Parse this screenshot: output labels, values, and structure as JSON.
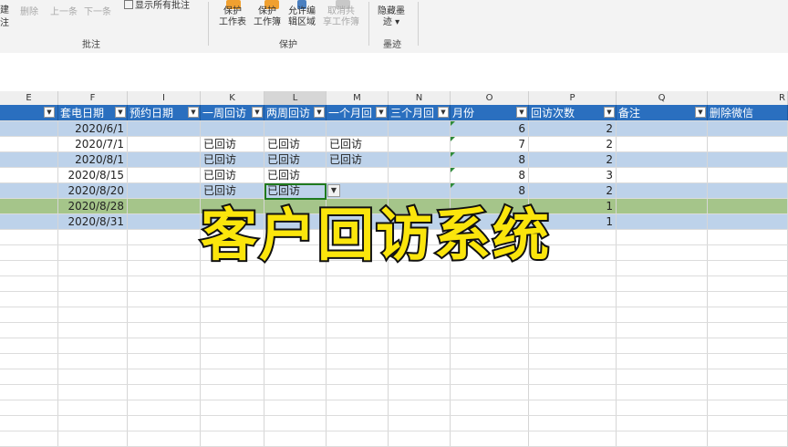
{
  "ribbon": {
    "left_partial": [
      "建",
      "注"
    ],
    "delete_label": "删除",
    "prev_label": "上一条",
    "next_label": "下一条",
    "show_all_label": "显示所有批注",
    "comment_group": "批注",
    "protect_sheet": [
      "保护",
      "工作表"
    ],
    "protect_workbook": [
      "保护",
      "工作簿"
    ],
    "allow_edit": [
      "允许编",
      "辑区域"
    ],
    "unshare": [
      "取消共",
      "享工作簿"
    ],
    "protect_group": "保护",
    "hide_ink": [
      "隐藏墨",
      "迹"
    ],
    "ink_group": "墨迹"
  },
  "columns": [
    {
      "letter": "E"
    },
    {
      "letter": "F"
    },
    {
      "letter": "I"
    },
    {
      "letter": "K"
    },
    {
      "letter": "L"
    },
    {
      "letter": "M"
    },
    {
      "letter": "N"
    },
    {
      "letter": "O"
    },
    {
      "letter": "P"
    },
    {
      "letter": "Q"
    },
    {
      "letter": "R"
    }
  ],
  "table_headers": [
    "",
    "套电日期",
    "预约日期",
    "一周回访",
    "两周回访",
    "一个月回",
    "三个月回",
    "月份",
    "回访次数",
    "备注",
    "删除微信"
  ],
  "rows": [
    {
      "date": "2020/6/1",
      "k": "",
      "l": "",
      "m": "",
      "month": "6",
      "count": "2",
      "style": "blue"
    },
    {
      "date": "2020/7/1",
      "k": "已回访",
      "l": "已回访",
      "m": "已回访",
      "month": "7",
      "count": "2",
      "style": "white"
    },
    {
      "date": "2020/8/1",
      "k": "已回访",
      "l": "已回访",
      "m": "已回访",
      "month": "8",
      "count": "2",
      "style": "blue"
    },
    {
      "date": "2020/8/15",
      "k": "已回访",
      "l": "已回访",
      "m": "",
      "month": "8",
      "count": "3",
      "style": "white"
    },
    {
      "date": "2020/8/20",
      "k": "已回访",
      "l": "已回访",
      "m": "",
      "month": "8",
      "count": "2",
      "style": "blue"
    },
    {
      "date": "2020/8/28",
      "k": "",
      "l": "",
      "m": "",
      "month": "",
      "count": "1",
      "style": "green"
    },
    {
      "date": "2020/8/31",
      "k": "",
      "l": "",
      "m": "",
      "month": "",
      "count": "1",
      "style": "blue"
    }
  ],
  "overlay_title": "客户回访系统",
  "colors": {
    "header_blue": "#2a6fbf",
    "band_blue": "#bdd2ea",
    "band_green": "#a5c58a",
    "title_yellow": "#fbe50c"
  }
}
